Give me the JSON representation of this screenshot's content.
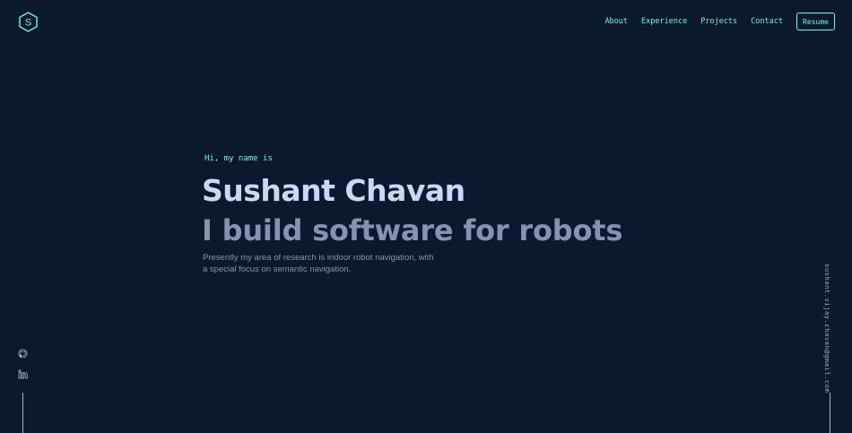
{
  "logo": {
    "letter": "S",
    "icon": "hexagon-logo-icon"
  },
  "nav": {
    "items": [
      {
        "label": "About"
      },
      {
        "label": "Experience"
      },
      {
        "label": "Projects"
      },
      {
        "label": "Contact"
      }
    ],
    "resume_label": "Resume"
  },
  "hero": {
    "greeting": "Hi, my name is",
    "name": "Sushant Chavan",
    "tagline": "I build software for robots",
    "description": "Presently my area of research is indoor robot navigation, with a special focus on semantic navigation."
  },
  "social": {
    "icons": [
      "github-icon",
      "linkedin-icon"
    ]
  },
  "email": "sushant.vijay.chavan@gmail.com",
  "colors": {
    "background": "#0b182e",
    "accent": "#64ffda",
    "heading": "#ccd6f6",
    "muted": "#8892b0",
    "light": "#a8b2d1"
  }
}
